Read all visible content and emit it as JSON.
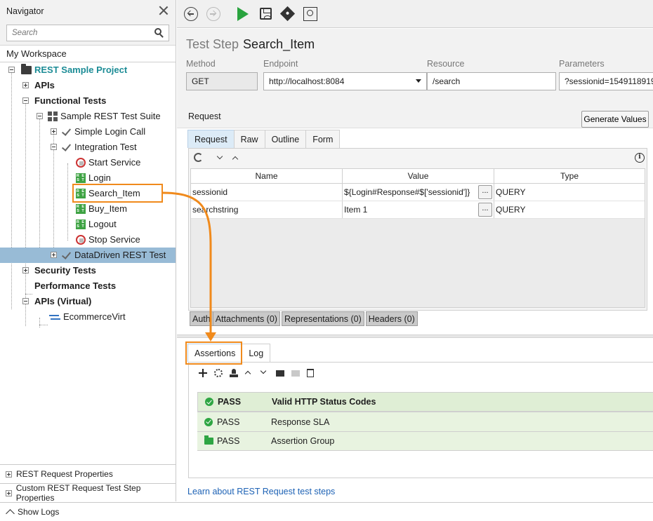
{
  "navigator": {
    "title": "Navigator",
    "search_placeholder": "Search",
    "workspace": "My Workspace",
    "tree": {
      "project": "REST Sample Project",
      "apis": "APIs",
      "functional_tests": "Functional Tests",
      "suite": "Sample REST Test Suite",
      "simple_login": "Simple Login Call",
      "integration": "Integration Test",
      "start_service": "Start Service",
      "login": "Login",
      "search_item": "Search_Item",
      "buy_item": "Buy_Item",
      "logout": "Logout",
      "stop_service": "Stop Service",
      "datadriven": "DataDriven REST Test",
      "security": "Security Tests",
      "performance": "Performance Tests",
      "apis_virtual": "APIs (Virtual)",
      "virt": "EcommerceVirt"
    },
    "bottom": {
      "rest_props": "REST Request Properties",
      "custom_props": "Custom REST Request Test Step Properties"
    }
  },
  "show_logs": "Show Logs",
  "step": {
    "label": "Test Step",
    "name": "Search_Item",
    "fields": {
      "method_label": "Method",
      "method": "GET",
      "endpoint_label": "Endpoint",
      "endpoint": "http://localhost:8084",
      "resource_label": "Resource",
      "resource": "/search",
      "params_label": "Parameters",
      "params": "?sessionid=1549118919"
    }
  },
  "request": {
    "label": "Request",
    "generate_button": "Generate Values",
    "tabs": [
      "Request",
      "Raw",
      "Outline",
      "Form"
    ],
    "columns": [
      "Name",
      "Value",
      "Type"
    ],
    "rows": [
      {
        "name": "sessionid",
        "value": "${Login#Response#$['sessionid']}",
        "type": "QUERY"
      },
      {
        "name": "searchstring",
        "value": "Item 1",
        "type": "QUERY"
      }
    ],
    "ellipsis": "...",
    "subtabs": [
      "Auth",
      "Attachments (0)",
      "Representations (0)",
      "Headers (0)"
    ]
  },
  "assertions": {
    "tabs": [
      "Assertions",
      "Log"
    ],
    "items": [
      {
        "status": "PASS",
        "name": "Valid HTTP Status Codes"
      },
      {
        "status": "PASS",
        "name": "Response SLA"
      },
      {
        "status": "PASS",
        "name": "Assertion Group"
      }
    ]
  },
  "learn_link": "Learn about REST Request test steps",
  "colors": {
    "accent_highlight": "#f08a1c",
    "selection": "#98bbd6",
    "pass_green": "#2ea543",
    "project_teal": "#1c8c96"
  }
}
